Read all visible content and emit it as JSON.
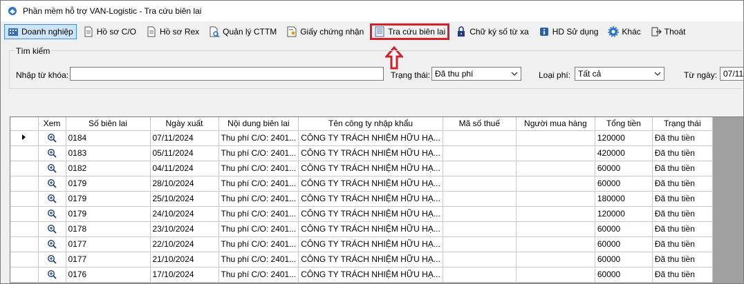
{
  "window": {
    "title": "Phần mềm hỗ trợ VAN-Logistic - Tra cứu biên lai"
  },
  "toolbar": {
    "items": [
      {
        "label": "Doanh nghiệp",
        "icon": "company-icon"
      },
      {
        "label": "Hồ sơ C/O",
        "icon": "document-icon"
      },
      {
        "label": "Hồ sơ Rex",
        "icon": "document-icon"
      },
      {
        "label": "Quản lý CTTM",
        "icon": "document-search-icon"
      },
      {
        "label": "Giấy chứng nhận",
        "icon": "certificate-icon"
      },
      {
        "label": "Tra cứu biên lai",
        "icon": "receipt-icon"
      },
      {
        "label": "Chữ ký số từ xa",
        "icon": "lock-icon"
      },
      {
        "label": "HD Sử dụng",
        "icon": "help-icon"
      },
      {
        "label": "Khác",
        "icon": "gear-icon"
      },
      {
        "label": "Thoát",
        "icon": "exit-icon"
      }
    ]
  },
  "search": {
    "legend": "Tìm kiếm",
    "keyword_label": "Nhập từ khóa:",
    "keyword_value": "",
    "status_label": "Trạng thái:",
    "status_value": "Đã thu phí",
    "fee_label": "Loại phí:",
    "fee_value": "Tất cả",
    "from_label": "Từ ngày:",
    "from_value": "07/11/"
  },
  "grid": {
    "columns": [
      "Xem",
      "Số biên lai",
      "Ngày xuất",
      "Nội dung biên lai",
      "Tên công ty nhập khẩu",
      "Mã số thuế",
      "Người mua hàng",
      "Tổng tiền",
      "Trạng thái"
    ],
    "rows": [
      {
        "so": "0184",
        "ngay": "07/11/2024",
        "noidung": "Thu phí C/O: 2401...",
        "cty": "CÔNG TY TRÁCH NHIỆM HỮU HẠ...",
        "mst": "",
        "nguoimua": "",
        "tong": "120000",
        "tt": "Đã thu tiền"
      },
      {
        "so": "0183",
        "ngay": "05/11/2024",
        "noidung": "Thu phí C/O: 2401...",
        "cty": "CÔNG TY TRÁCH NHIỆM HỮU HẠ...",
        "mst": "",
        "nguoimua": "",
        "tong": "420000",
        "tt": "Đã thu tiền"
      },
      {
        "so": "0182",
        "ngay": "04/11/2024",
        "noidung": "Thu phí C/O: 2401...",
        "cty": "CÔNG TY TRÁCH NHIỆM HỮU HẠ...",
        "mst": "",
        "nguoimua": "",
        "tong": "60000",
        "tt": "Đã thu tiền"
      },
      {
        "so": "0179",
        "ngay": "28/10/2024",
        "noidung": "Thu phí C/O: 2401...",
        "cty": "CÔNG TY TRÁCH NHIỆM HỮU HẠ...",
        "mst": "",
        "nguoimua": "",
        "tong": "60000",
        "tt": "Đã thu tiền"
      },
      {
        "so": "0179",
        "ngay": "25/10/2024",
        "noidung": "Thu phí C/O: 2401...",
        "cty": "CÔNG TY TRÁCH NHIỆM HỮU HẠ...",
        "mst": "",
        "nguoimua": "",
        "tong": "180000",
        "tt": "Đã thu tiền"
      },
      {
        "so": "0179",
        "ngay": "24/10/2024",
        "noidung": "Thu phí C/O: 2401...",
        "cty": "CÔNG TY TRÁCH NHIỆM HỮU HẠ...",
        "mst": "",
        "nguoimua": "",
        "tong": "120000",
        "tt": "Đã thu tiền"
      },
      {
        "so": "0178",
        "ngay": "23/10/2024",
        "noidung": "Thu phí C/O: 2401...",
        "cty": "CÔNG TY TRÁCH NHIỆM HỮU HẠ...",
        "mst": "",
        "nguoimua": "",
        "tong": "60000",
        "tt": "Đã thu tiền"
      },
      {
        "so": "0177",
        "ngay": "22/10/2024",
        "noidung": "Thu phí C/O: 2401...",
        "cty": "CÔNG TY TRÁCH NHIỆM HỮU HẠ...",
        "mst": "",
        "nguoimua": "",
        "tong": "60000",
        "tt": "Đã thu tiền"
      },
      {
        "so": "0177",
        "ngay": "21/10/2024",
        "noidung": "Thu phí C/O: 2401...",
        "cty": "CÔNG TY TRÁCH NHIỆM HỮU HẠ...",
        "mst": "",
        "nguoimua": "",
        "tong": "60000",
        "tt": "Đã thu tiền"
      },
      {
        "so": "0176",
        "ngay": "17/10/2024",
        "noidung": "Thu phí C/O: 2401...",
        "cty": "CÔNG TY TRÁCH NHIỆM HỮU HẠ...",
        "mst": "",
        "nguoimua": "",
        "tong": "60000",
        "tt": "Đã thu tiền"
      }
    ]
  },
  "colors": {
    "highlight": "#d3202a",
    "selected_bg": "#cce4f7",
    "grid_empty_bg": "#a0a0a0"
  }
}
